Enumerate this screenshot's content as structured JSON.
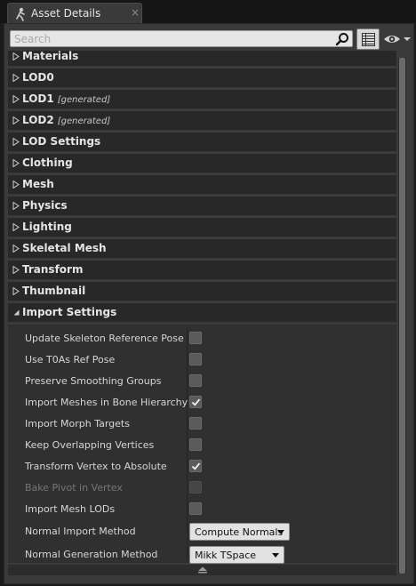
{
  "tab": {
    "title": "Asset Details",
    "close": "×",
    "icon": "skeletal-mesh-icon"
  },
  "search": {
    "placeholder": "Search",
    "value": ""
  },
  "toolbar": {
    "grid_icon": "property-matrix-icon",
    "eye_icon": "view-options-icon"
  },
  "categories": [
    {
      "label": "Materials",
      "expanded": false,
      "tag": ""
    },
    {
      "label": "LOD0",
      "expanded": false,
      "tag": ""
    },
    {
      "label": "LOD1",
      "expanded": false,
      "tag": "[generated]"
    },
    {
      "label": "LOD2",
      "expanded": false,
      "tag": "[generated]"
    },
    {
      "label": "LOD Settings",
      "expanded": false,
      "tag": ""
    },
    {
      "label": "Clothing",
      "expanded": false,
      "tag": ""
    },
    {
      "label": "Mesh",
      "expanded": false,
      "tag": ""
    },
    {
      "label": "Physics",
      "expanded": false,
      "tag": ""
    },
    {
      "label": "Lighting",
      "expanded": false,
      "tag": ""
    },
    {
      "label": "Skeletal Mesh",
      "expanded": false,
      "tag": ""
    },
    {
      "label": "Transform",
      "expanded": false,
      "tag": ""
    },
    {
      "label": "Thumbnail",
      "expanded": false,
      "tag": ""
    },
    {
      "label": "Import Settings",
      "expanded": true,
      "tag": ""
    }
  ],
  "import_settings": [
    {
      "label": "Update Skeleton Reference Pose",
      "checked": false,
      "enabled": true
    },
    {
      "label": "Use T0As Ref Pose",
      "checked": false,
      "enabled": true
    },
    {
      "label": "Preserve Smoothing Groups",
      "checked": false,
      "enabled": true
    },
    {
      "label": "Import Meshes in Bone Hierarchy",
      "checked": true,
      "enabled": true
    },
    {
      "label": "Import Morph Targets",
      "checked": false,
      "enabled": true
    },
    {
      "label": "Keep Overlapping Vertices",
      "checked": false,
      "enabled": true
    },
    {
      "label": "Transform Vertex to Absolute",
      "checked": true,
      "enabled": true
    },
    {
      "label": "Bake Pivot in Vertex",
      "checked": false,
      "enabled": false
    },
    {
      "label": "Import Mesh LODs",
      "checked": false,
      "enabled": true
    }
  ],
  "combos": [
    {
      "label": "Normal Import Method",
      "value": "Compute Normals"
    },
    {
      "label": "Normal Generation Method",
      "value": "Mikk TSpace"
    }
  ],
  "colors": {
    "panel": "#3a3a3a",
    "category": "#282828",
    "accent": "#d8d8d8"
  }
}
